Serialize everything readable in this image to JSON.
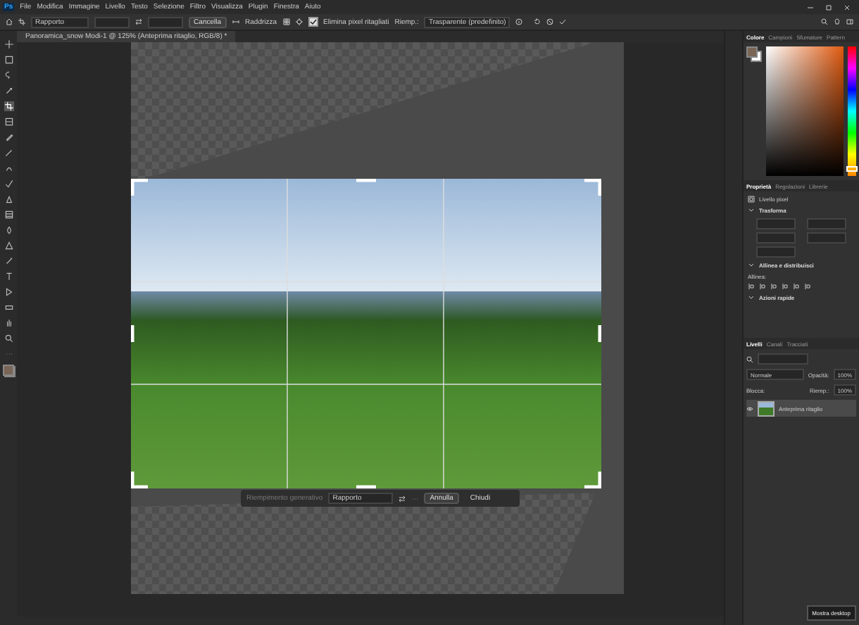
{
  "app_logo": "Ps",
  "menu": [
    "File",
    "Modifica",
    "Immagine",
    "Livello",
    "Testo",
    "Selezione",
    "Filtro",
    "Visualizza",
    "Plugin",
    "Finestra",
    "Aiuto"
  ],
  "options_bar": {
    "ratio": "Rapporto",
    "clear_button": "Cancella",
    "straighten": "Raddrizza",
    "delete_pixels": {
      "label": "Elimina pixel ritagliati",
      "checked": true
    },
    "fill_label": "Riemp.:",
    "fill_value": "Trasparente (predefinito)"
  },
  "document_tab": {
    "title": "Panoramica_snow Modi-1 @ 125% (Anteprima ritaglio, RGB/8) *"
  },
  "tools": [
    {
      "selected": false
    },
    {
      "selected": false
    },
    {
      "selected": false
    },
    {
      "selected": false
    },
    {
      "selected": true
    },
    {
      "selected": false
    },
    {
      "selected": false
    },
    {
      "selected": false
    },
    {
      "selected": false
    },
    {
      "selected": false
    },
    {
      "selected": false
    },
    {
      "selected": false
    },
    {
      "selected": false
    },
    {
      "selected": false
    },
    {
      "selected": false
    },
    {
      "selected": false
    },
    {
      "selected": false
    },
    {
      "selected": false
    },
    {
      "selected": false
    },
    {
      "selected": false
    },
    {
      "selected": false
    }
  ],
  "crop_bar": {
    "generative": "Riempimento generativo",
    "ratio": "Rapporto",
    "cancel": "Annulla",
    "close": "Chiudi"
  },
  "color_tabs": [
    {
      "label": "Colore",
      "selected": true
    },
    {
      "label": "Campioni",
      "selected": false
    },
    {
      "label": "Sfumature",
      "selected": false
    },
    {
      "label": "Pattern",
      "selected": false
    }
  ],
  "hue_slider": {
    "level": 0.06
  },
  "properties_tabs": [
    {
      "label": "Proprietà",
      "selected": true
    },
    {
      "label": "Regolazioni",
      "selected": false
    },
    {
      "label": "Librerie",
      "selected": false
    }
  ],
  "layer_kind": "Livello pixel",
  "sections": [
    {
      "title": "Trasforma",
      "expanded": true
    },
    {
      "title": "Allinea e distribuisci",
      "expanded": true
    },
    {
      "title": "Azioni rapide",
      "expanded": true
    }
  ],
  "align_label": "Allinea:",
  "layers_tabs": [
    {
      "label": "Livelli",
      "selected": true
    },
    {
      "label": "Canali",
      "selected": false
    },
    {
      "label": "Tracciati",
      "selected": false
    }
  ],
  "blend_mode": "Normale",
  "opacity_label": "Opacità:",
  "opacity_value": "100%",
  "lock_label": "Blocca:",
  "fill_label": "Riemp.:",
  "fill_value": "100%",
  "layers": [
    {
      "name": "Anteprima ritaglio",
      "visible": true,
      "selected": true
    }
  ],
  "tooltip": "Mostra desktop"
}
